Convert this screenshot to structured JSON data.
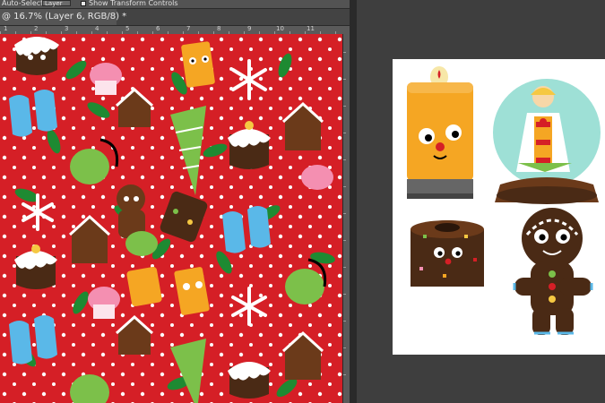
{
  "options_bar": {
    "auto_select_label": "Auto-Select:",
    "auto_select_value": "Layer",
    "show_transform_label": "Show Transform Controls"
  },
  "document_tab": {
    "title": "@ 16.7% (Layer 6, RGB/8) *"
  },
  "ruler": {
    "labels": [
      "1",
      "2",
      "3",
      "4",
      "5",
      "6",
      "7",
      "8",
      "9",
      "10",
      "11"
    ]
  },
  "colors": {
    "pattern_background": "#d51f26",
    "workspace": "#3a3a3a",
    "artboard": "#ffffff"
  }
}
